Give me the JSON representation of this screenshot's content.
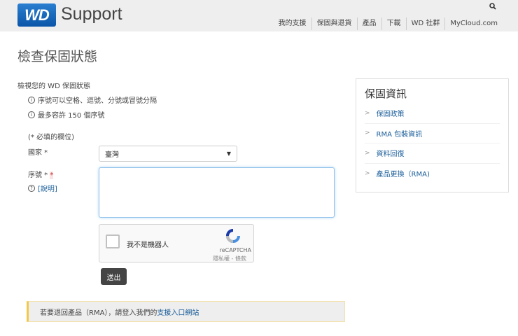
{
  "header": {
    "logo": "WD",
    "brand": "Support",
    "nav": [
      "我的支援",
      "保固與退貨",
      "產品",
      "下載",
      "WD 社群",
      "MyCloud.com"
    ]
  },
  "page_title": "檢查保固狀態",
  "intro": "檢視您的 WD 保固狀態",
  "info": [
    "序號可以空格、逗號、分號或冒號分隔",
    "最多容許 150 個序號"
  ],
  "required_note": "(* 必填的欄位)",
  "form": {
    "country_label": "國家 *",
    "country_value": "臺灣",
    "serial_label": "序號 *",
    "serial_required": "*",
    "help_link": "[說明]",
    "serial_value": ""
  },
  "captcha": {
    "label": "我不是機器人",
    "brand": "reCAPTCHA",
    "links": "隱私權 - 條款"
  },
  "submit": "送出",
  "alert": {
    "text": "若要退回產品（RMA），請登入我們的",
    "link": "支援入口網站"
  },
  "panel": {
    "title": "保固資訊",
    "items": [
      "保固政策",
      "RMA 包裝資訊",
      "資料回復",
      "產品更換（RMA)"
    ]
  }
}
